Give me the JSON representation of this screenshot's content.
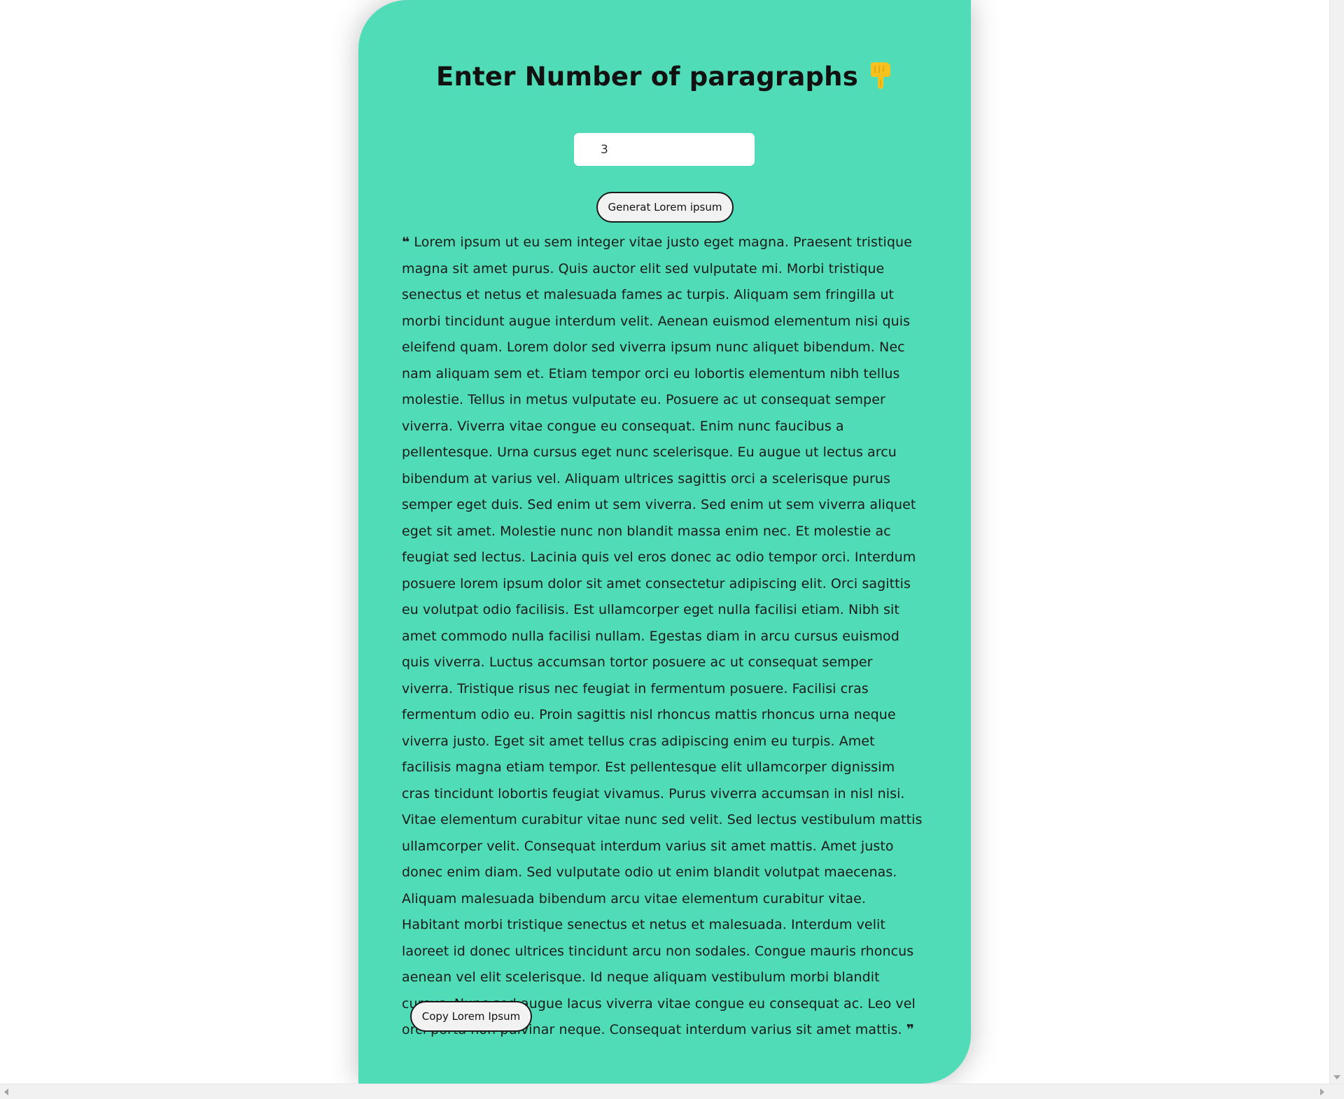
{
  "theme": {
    "card_bg": "#50dcb6",
    "emoji_color": "#f7c21d"
  },
  "header": {
    "title": "Enter Number of paragraphs",
    "emoji_icon": "pointing-down-hand-icon"
  },
  "form": {
    "paragraph_count": "3",
    "generate_label": "Generat Lorem ipsum"
  },
  "output": {
    "open_quote": "❝",
    "close_quote": "❞",
    "text": "Lorem ipsum ut eu sem integer vitae justo eget magna. Praesent tristique magna sit amet purus. Quis auctor elit sed vulputate mi. Morbi tristique senectus et netus et malesuada fames ac turpis. Aliquam sem fringilla ut morbi tincidunt augue interdum velit. Aenean euismod elementum nisi quis eleifend quam. Lorem dolor sed viverra ipsum nunc aliquet bibendum. Nec nam aliquam sem et. Etiam tempor orci eu lobortis elementum nibh tellus molestie. Tellus in metus vulputate eu. Posuere ac ut consequat semper viverra. Viverra vitae congue eu consequat. Enim nunc faucibus a pellentesque. Urna cursus eget nunc scelerisque. Eu augue ut lectus arcu bibendum at varius vel. Aliquam ultrices sagittis orci a scelerisque purus semper eget duis. Sed enim ut sem viverra. Sed enim ut sem viverra aliquet eget sit amet. Molestie nunc non blandit massa enim nec. Et molestie ac feugiat sed lectus. Lacinia quis vel eros donec ac odio tempor orci. Interdum posuere lorem ipsum dolor sit amet consectetur adipiscing elit. Orci sagittis eu volutpat odio facilisis. Est ullamcorper eget nulla facilisi etiam. Nibh sit amet commodo nulla facilisi nullam. Egestas diam in arcu cursus euismod quis viverra. Luctus accumsan tortor posuere ac ut consequat semper viverra. Tristique risus nec feugiat in fermentum posuere. Facilisi cras fermentum odio eu. Proin sagittis nisl rhoncus mattis rhoncus urna neque viverra justo. Eget sit amet tellus cras adipiscing enim eu turpis. Amet facilisis magna etiam tempor. Est pellentesque elit ullamcorper dignissim cras tincidunt lobortis feugiat vivamus. Purus viverra accumsan in nisl nisi. Vitae elementum curabitur vitae nunc sed velit. Sed lectus vestibulum mattis ullamcorper velit. Consequat interdum varius sit amet mattis. Amet justo donec enim diam. Sed vulputate odio ut enim blandit volutpat maecenas. Aliquam malesuada bibendum arcu vitae elementum curabitur vitae. Habitant morbi tristique senectus et netus et malesuada. Interdum velit laoreet id donec ultrices tincidunt arcu non sodales. Congue mauris rhoncus aenean vel elit scelerisque. Id neque aliquam vestibulum morbi blandit cursus. Nunc sed augue lacus viverra vitae congue eu consequat ac. Leo vel orci porta non pulvinar neque. Consequat interdum varius sit amet mattis."
  },
  "actions": {
    "copy_label": "Copy Lorem Ipsum"
  }
}
